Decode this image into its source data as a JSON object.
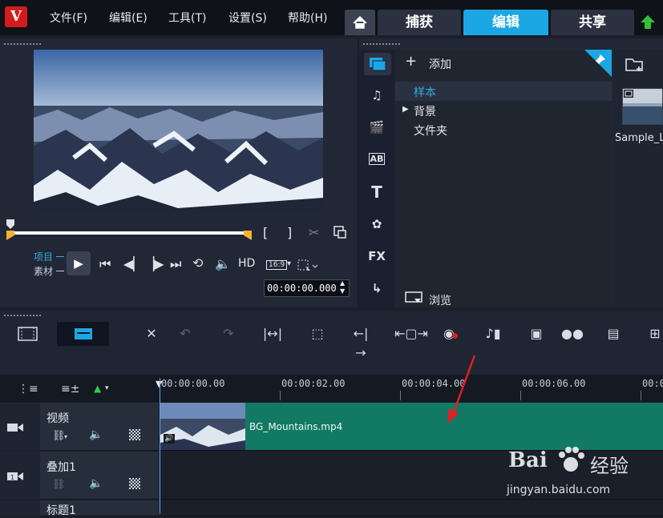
{
  "menu": {
    "logo": "V",
    "items": [
      "文件(F)",
      "编辑(E)",
      "工具(T)",
      "设置(S)",
      "帮助(H)"
    ]
  },
  "mode_tabs": [
    "捕获",
    "编辑",
    "共享"
  ],
  "active_mode": "编辑",
  "preview": {
    "mode_project": "项目",
    "mode_clip": "素材",
    "hd_label": "HD",
    "aspect": "16:9",
    "timecode": "00:00:00.000",
    "mark_in": "[",
    "mark_out": "]"
  },
  "library": {
    "add_label": "添加",
    "tree": [
      "样本",
      "背景",
      "文件夹"
    ],
    "selected": "样本",
    "browse_label": "浏览",
    "side_icons": [
      "media-icon",
      "audio-icon",
      "instant-project-icon",
      "transition-icon",
      "title-icon",
      "graphic-icon",
      "fx-icon",
      "path-icon"
    ],
    "fx_label": "FX",
    "thumb_label": "Sample_L"
  },
  "timeline": {
    "ticks": [
      "00:00:00.00",
      "00:00:02.00",
      "00:00:04.00",
      "00:00:06.00",
      "00:00:0"
    ],
    "tracks": [
      {
        "name": "视频"
      },
      {
        "name": "叠加1"
      },
      {
        "name": "标题1"
      }
    ],
    "clip_name": "BG_Mountains.mp4"
  },
  "watermark": {
    "brand": "Bai",
    "brand2": "经验",
    "url": "jingyan.baidu.com"
  },
  "colors": {
    "accent": "#1ba7e3",
    "clip": "#127a64",
    "annotation_arrow": "#e02020"
  }
}
